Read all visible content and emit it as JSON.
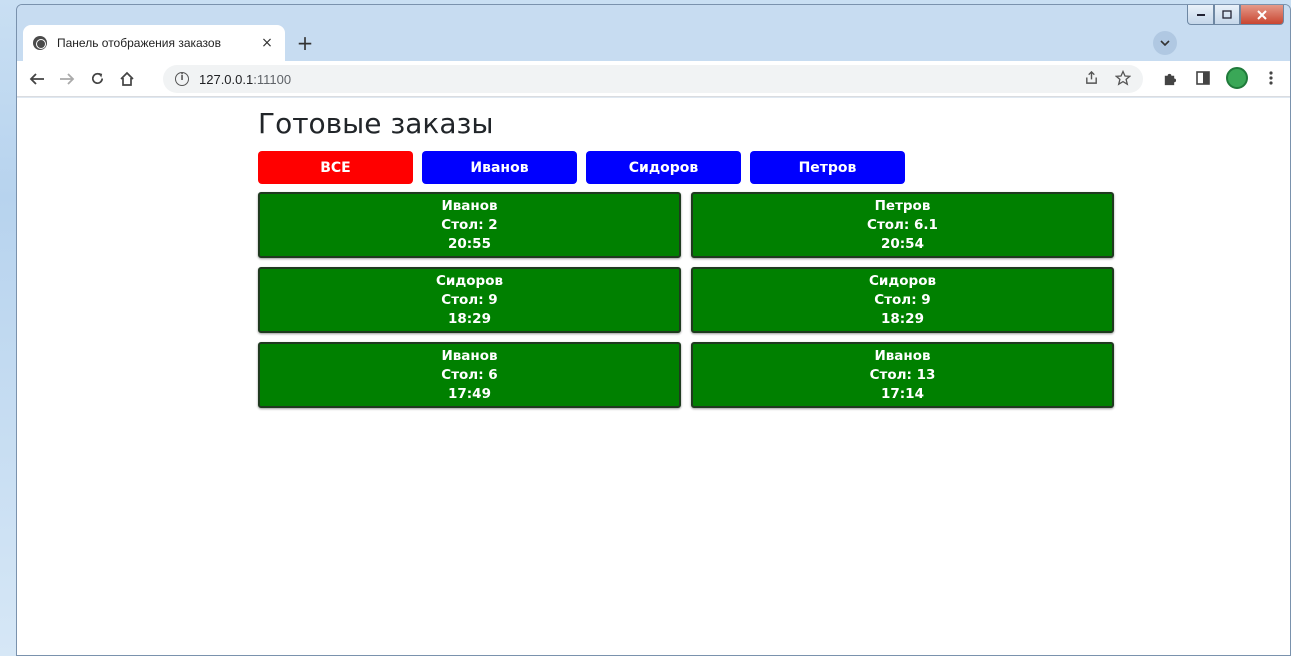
{
  "browser": {
    "tab_title": "Панель отображения заказов",
    "tab_close": "×",
    "new_tab": "+",
    "url_host": "127.0.0.1",
    "url_port": ":11100",
    "info_glyph": "i"
  },
  "page": {
    "title": "Готовые заказы"
  },
  "filters": [
    {
      "label": "ВСЕ",
      "color": "#ff0000"
    },
    {
      "label": "Иванов",
      "color": "#0000ff"
    },
    {
      "label": "Сидоров",
      "color": "#0000ff"
    },
    {
      "label": "Петров",
      "color": "#0000ff"
    }
  ],
  "orders": [
    {
      "waiter": "Иванов",
      "table": "Стол: 2",
      "time": "20:55"
    },
    {
      "waiter": "Петров",
      "table": "Стол: 6.1",
      "time": "20:54"
    },
    {
      "waiter": "Сидоров",
      "table": "Стол: 9",
      "time": "18:29"
    },
    {
      "waiter": "Сидоров",
      "table": "Стол: 9",
      "time": "18:29"
    },
    {
      "waiter": "Иванов",
      "table": "Стол: 6",
      "time": "17:49"
    },
    {
      "waiter": "Иванов",
      "table": "Стол: 13",
      "time": "17:14"
    }
  ],
  "colors": {
    "order_bg": "#008000",
    "active_filter": "#ff0000",
    "filter": "#0000ff"
  }
}
